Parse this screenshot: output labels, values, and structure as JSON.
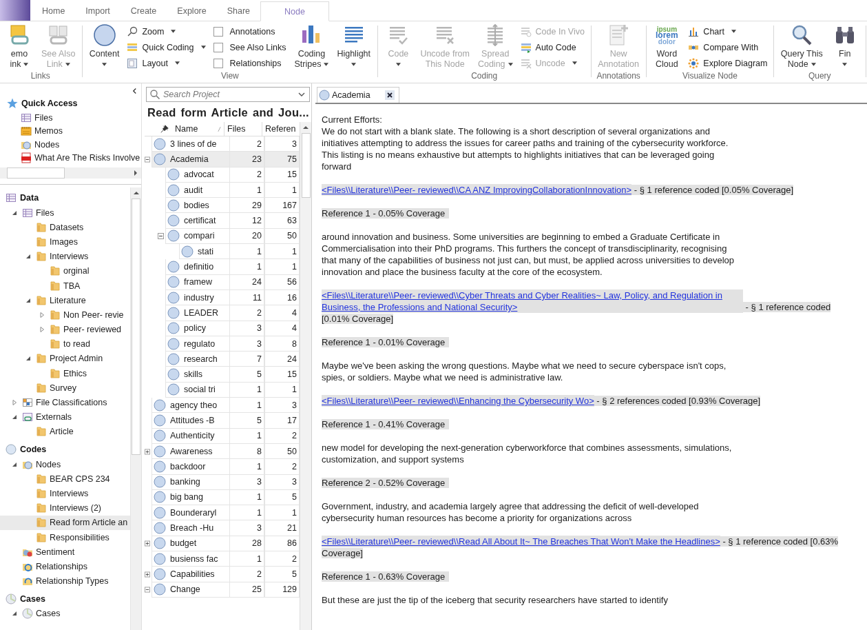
{
  "ribbon": {
    "tabs": [
      {
        "label": "Home",
        "selected": false
      },
      {
        "label": "Import",
        "selected": false
      },
      {
        "label": "Create",
        "selected": false
      },
      {
        "label": "Explore",
        "selected": false
      },
      {
        "label": "Share",
        "selected": false
      },
      {
        "label": "Node",
        "selected": true
      }
    ],
    "groups": [
      {
        "label": "Links",
        "columns": [
          {
            "kind": "large",
            "buttons": [
              {
                "kind": "large",
                "lines": [
                  "emo",
                  "ink"
                ],
                "dropdown": true,
                "disabled": false
              }
            ]
          },
          {
            "kind": "large",
            "buttons": [
              {
                "kind": "large",
                "lines": [
                  "See Also",
                  "Link"
                ],
                "dropdown": true,
                "disabled": true
              }
            ]
          }
        ]
      },
      {
        "label": "View",
        "columns": [
          {
            "kind": "large",
            "buttons": [
              {
                "kind": "large",
                "lines": [
                  "Content"
                ],
                "dropdown": true,
                "disabled": false
              }
            ]
          },
          {
            "kind": "stack",
            "buttons": [
              {
                "kind": "small",
                "label": "Zoom",
                "dropdown": true,
                "disabled": false
              },
              {
                "kind": "small",
                "label": "Quick Coding",
                "dropdown": true,
                "disabled": false
              },
              {
                "kind": "small",
                "label": "Layout",
                "dropdown": true,
                "disabled": false
              }
            ]
          },
          {
            "kind": "stack",
            "buttons": [
              {
                "kind": "check",
                "label": "Annotations",
                "checked": false
              },
              {
                "kind": "check",
                "label": "See Also Links",
                "checked": false
              },
              {
                "kind": "check",
                "label": "Relationships",
                "checked": false
              }
            ]
          },
          {
            "kind": "large",
            "buttons": [
              {
                "kind": "large",
                "lines": [
                  "Coding",
                  "Stripes"
                ],
                "dropdown": true,
                "disabled": false
              }
            ]
          },
          {
            "kind": "large",
            "buttons": [
              {
                "kind": "large",
                "lines": [
                  "Highlight"
                ],
                "dropdown": true,
                "disabled": false
              }
            ]
          }
        ]
      },
      {
        "label": "Coding",
        "columns": [
          {
            "kind": "large",
            "buttons": [
              {
                "kind": "large",
                "lines": [
                  "Code"
                ],
                "dropdown": true,
                "disabled": true
              }
            ]
          },
          {
            "kind": "large",
            "buttons": [
              {
                "kind": "large",
                "lines": [
                  "Uncode from",
                  "This Node"
                ],
                "dropdown": false,
                "disabled": true
              }
            ]
          },
          {
            "kind": "large",
            "buttons": [
              {
                "kind": "large",
                "lines": [
                  "Spread",
                  "Coding"
                ],
                "dropdown": true,
                "disabled": true
              }
            ]
          },
          {
            "kind": "stack",
            "buttons": [
              {
                "kind": "small",
                "label": "Code In Vivo",
                "dropdown": false,
                "disabled": true
              },
              {
                "kind": "small",
                "label": "Auto Code",
                "dropdown": false,
                "disabled": false
              },
              {
                "kind": "small",
                "label": "Uncode",
                "dropdown": true,
                "disabled": true
              }
            ]
          }
        ]
      },
      {
        "label": "Annotations",
        "columns": [
          {
            "kind": "large",
            "buttons": [
              {
                "kind": "large",
                "lines": [
                  "New",
                  "Annotation"
                ],
                "dropdown": false,
                "disabled": true
              }
            ]
          }
        ]
      },
      {
        "label": "Visualize Node",
        "columns": [
          {
            "kind": "large",
            "buttons": [
              {
                "kind": "large",
                "lines": [
                  "Word",
                  "Cloud"
                ],
                "dropdown": false,
                "disabled": false,
                "icon_words": [
                  "ipsum",
                  "lorem",
                  "dolor"
                ]
              }
            ]
          },
          {
            "kind": "stack",
            "buttons": [
              {
                "kind": "small",
                "label": "Chart",
                "dropdown": true,
                "disabled": false
              },
              {
                "kind": "small",
                "label": "Compare With",
                "dropdown": false,
                "disabled": false
              },
              {
                "kind": "small",
                "label": "Explore Diagram",
                "dropdown": false,
                "disabled": false
              }
            ]
          }
        ]
      },
      {
        "label": "Query",
        "columns": [
          {
            "kind": "large",
            "buttons": [
              {
                "kind": "large",
                "lines": [
                  "Query This",
                  "Node"
                ],
                "dropdown": true,
                "disabled": false
              }
            ]
          },
          {
            "kind": "large",
            "buttons": [
              {
                "kind": "large",
                "lines": [
                  "Fin"
                ],
                "dropdown": true,
                "disabled": false
              }
            ]
          }
        ]
      }
    ]
  },
  "nav": {
    "quick_access": {
      "title": "Quick Access",
      "items": [
        {
          "label": "Files",
          "kind": "files",
          "selected": false
        },
        {
          "label": "Memos",
          "kind": "memos",
          "selected": false
        },
        {
          "label": "Nodes",
          "kind": "nodes",
          "selected": false
        },
        {
          "label": "What Are The Risks Involve",
          "kind": "pdf",
          "selected": false
        }
      ]
    },
    "sections": [
      {
        "title": "Data",
        "kind": "data",
        "items": [
          {
            "label": "Files",
            "kind": "files",
            "expanded": true,
            "selected": false,
            "children": [
              {
                "label": "Datasets",
                "kind": "folder",
                "selected": false
              },
              {
                "label": "Images",
                "kind": "folder",
                "selected": false
              },
              {
                "label": "Interviews",
                "kind": "folder",
                "expanded": true,
                "selected": false,
                "children": [
                  {
                    "label": "orginal",
                    "kind": "folder",
                    "selected": false
                  },
                  {
                    "label": "TBA",
                    "kind": "folder",
                    "selected": false
                  }
                ]
              },
              {
                "label": "Literature",
                "kind": "folder",
                "expanded": true,
                "selected": false,
                "children": [
                  {
                    "label": "Non Peer- revie",
                    "kind": "folder",
                    "expanded": false,
                    "selected": false
                  },
                  {
                    "label": "Peer- reviewed",
                    "kind": "folder",
                    "expanded": false,
                    "selected": false
                  },
                  {
                    "label": "to read",
                    "kind": "folder",
                    "selected": false
                  }
                ]
              },
              {
                "label": "Project Admin",
                "kind": "folder",
                "expanded": true,
                "selected": false,
                "children": [
                  {
                    "label": "Ethics",
                    "kind": "folder",
                    "selected": false
                  }
                ]
              },
              {
                "label": "Survey",
                "kind": "folder",
                "selected": false
              }
            ]
          },
          {
            "label": "File Classifications",
            "kind": "classification",
            "expanded": false,
            "selected": false
          },
          {
            "label": "Externals",
            "kind": "externals",
            "expanded": true,
            "selected": false,
            "children": [
              {
                "label": "Article",
                "kind": "folder",
                "selected": false
              }
            ]
          }
        ]
      },
      {
        "title": "Codes",
        "kind": "codes",
        "items": [
          {
            "label": "Nodes",
            "kind": "nodes",
            "expanded": true,
            "selected": false,
            "children": [
              {
                "label": "BEAR CPS 234",
                "kind": "folder",
                "selected": false
              },
              {
                "label": "Interviews",
                "kind": "folder",
                "selected": false
              },
              {
                "label": "Interviews (2)",
                "kind": "folder",
                "selected": false
              },
              {
                "label": "Read form Article an",
                "kind": "folder",
                "selected": true
              },
              {
                "label": "Responsibilities",
                "kind": "folder",
                "selected": false
              }
            ]
          },
          {
            "label": "Sentiment",
            "kind": "sentiment",
            "selected": false
          },
          {
            "label": "Relationships",
            "kind": "relationships",
            "selected": false
          },
          {
            "label": "Relationship Types",
            "kind": "reltypes",
            "selected": false
          }
        ]
      },
      {
        "title": "Cases",
        "kind": "cases",
        "items": [
          {
            "label": "Cases",
            "kind": "cases",
            "expanded": true,
            "selected": false
          }
        ]
      }
    ]
  },
  "list": {
    "search": {
      "placeholder": "Search Project"
    },
    "title": "Read form Article and Jou...",
    "columns": [
      "Name",
      "Files",
      "Referen"
    ],
    "rows": [
      {
        "name": "3 lines of de",
        "files": "2",
        "refs": "3",
        "selected": false
      },
      {
        "name": "Academia",
        "files": "23",
        "refs": "75",
        "selected": true,
        "expanded": true,
        "children": [
          {
            "name": "advocat",
            "files": "2",
            "refs": "15",
            "selected": false
          },
          {
            "name": "audit",
            "files": "1",
            "refs": "1",
            "selected": false
          },
          {
            "name": "bodies",
            "files": "29",
            "refs": "167",
            "selected": false
          },
          {
            "name": "certificat",
            "files": "12",
            "refs": "63",
            "selected": false
          },
          {
            "name": "compari",
            "files": "20",
            "refs": "50",
            "selected": false,
            "expanded": true,
            "children": [
              {
                "name": "stati",
                "files": "1",
                "refs": "1",
                "selected": false
              }
            ]
          },
          {
            "name": "definitio",
            "files": "1",
            "refs": "1",
            "selected": false
          },
          {
            "name": "framew",
            "files": "24",
            "refs": "56",
            "selected": false
          },
          {
            "name": "industry",
            "files": "11",
            "refs": "16",
            "selected": false
          },
          {
            "name": "LEADER",
            "files": "2",
            "refs": "4",
            "selected": false
          },
          {
            "name": "policy",
            "files": "3",
            "refs": "4",
            "selected": false
          },
          {
            "name": "regulato",
            "files": "3",
            "refs": "8",
            "selected": false
          },
          {
            "name": "research",
            "files": "7",
            "refs": "24",
            "selected": false
          },
          {
            "name": "skills",
            "files": "5",
            "refs": "15",
            "selected": false
          },
          {
            "name": "social tri",
            "files": "1",
            "refs": "1",
            "selected": false
          }
        ]
      },
      {
        "name": "agency theo",
        "files": "1",
        "refs": "3",
        "selected": false
      },
      {
        "name": "Attitudes -B",
        "files": "5",
        "refs": "17",
        "selected": false
      },
      {
        "name": "Authenticity",
        "files": "1",
        "refs": "2",
        "selected": false
      },
      {
        "name": "Awareness",
        "files": "8",
        "refs": "50",
        "selected": false,
        "expanded": false
      },
      {
        "name": "backdoor",
        "files": "1",
        "refs": "2",
        "selected": false
      },
      {
        "name": "banking",
        "files": "3",
        "refs": "3",
        "selected": false
      },
      {
        "name": "big bang",
        "files": "1",
        "refs": "5",
        "selected": false
      },
      {
        "name": "Bounderaryl",
        "files": "1",
        "refs": "1",
        "selected": false
      },
      {
        "name": "Breach -Hu",
        "files": "3",
        "refs": "21",
        "selected": false
      },
      {
        "name": "budget",
        "files": "28",
        "refs": "86",
        "selected": false,
        "expanded": false
      },
      {
        "name": "busienss fac",
        "files": "1",
        "refs": "2",
        "selected": false
      },
      {
        "name": "Capabilities",
        "files": "2",
        "refs": "5",
        "selected": false,
        "expanded": false
      },
      {
        "name": "Change",
        "files": "25",
        "refs": "129",
        "selected": false,
        "expanded": true
      }
    ]
  },
  "detail": {
    "tab": {
      "label": "Academia"
    },
    "blocks": [
      {
        "kind": "text",
        "lines": [
          "Current Efforts:",
          "We do not start with a blank slate. The following is a short description of several organizations and initiatives attempting to address the issues for career paths and training of the cybersecurity workforce. This listing is no means exhaustive but attempts to highlights initiatives that can be leveraged going forward"
        ]
      },
      {
        "kind": "source",
        "link": "<Files\\\\Literature\\\\Peer- reviewed\\\\CA ANZ ImprovingCollaborationInnovation>",
        "note": " - § 1 reference coded  [0.05% Coverage]"
      },
      {
        "kind": "reference",
        "text": "Reference 1 - 0.05% Coverage"
      },
      {
        "kind": "text",
        "lines": [
          "around innovation and business. Some universities are beginning to embed a Graduate Certificate in Commercialisation into their PhD programs. This furthers the concept of transdisciplinarity, recognising that many of the capabilities of business not just can, but must, be applied across universities to develop innovation and place the business faculty at the core of the ecosystem."
        ]
      },
      {
        "kind": "source",
        "link": "<Files\\\\Literature\\\\Peer- reviewed\\\\Cyber Threats and Cyber Realities~ Law, Policy, and Regulation in Business, the Professions and National Security>",
        "note": " - § 1 reference coded  [0.01% Coverage]"
      },
      {
        "kind": "reference",
        "text": "Reference 1 - 0.01% Coverage"
      },
      {
        "kind": "text",
        "lines": [
          "Maybe we've been asking the wrong questions. Maybe what we need to secure cyberspace isn't cops, spies, or soldiers. Maybe what we need is administrative law."
        ]
      },
      {
        "kind": "source",
        "link": "<Files\\\\Literature\\\\Peer- reviewed\\\\Enhancing the Cybersecurity Wo>",
        "note": " - § 2 references coded  [0.93% Coverage]"
      },
      {
        "kind": "reference",
        "text": "Reference 1 - 0.41% Coverage"
      },
      {
        "kind": "text",
        "lines": [
          "new model for developing the next-generation cyberworkforce that combines assessments, simulations, customization, and support systems"
        ]
      },
      {
        "kind": "reference",
        "text": "Reference 2 - 0.52% Coverage"
      },
      {
        "kind": "text",
        "lines": [
          "Government, industry, and academia largely agree that addressing the deficit of well-developed cybersecurity human resources has become a priority for organizations across"
        ]
      },
      {
        "kind": "source",
        "link": "<Files\\\\Literature\\\\Peer- reviewed\\\\Read All About It~ The Breaches That Won't Make the Headlines>",
        "note": " - § 1 reference coded  [0.63% Coverage]"
      },
      {
        "kind": "reference",
        "text": "Reference 1 - 0.63% Coverage"
      },
      {
        "kind": "text",
        "lines": [
          "But these are just the tip of the iceberg that security researchers have started to identify"
        ]
      }
    ]
  }
}
